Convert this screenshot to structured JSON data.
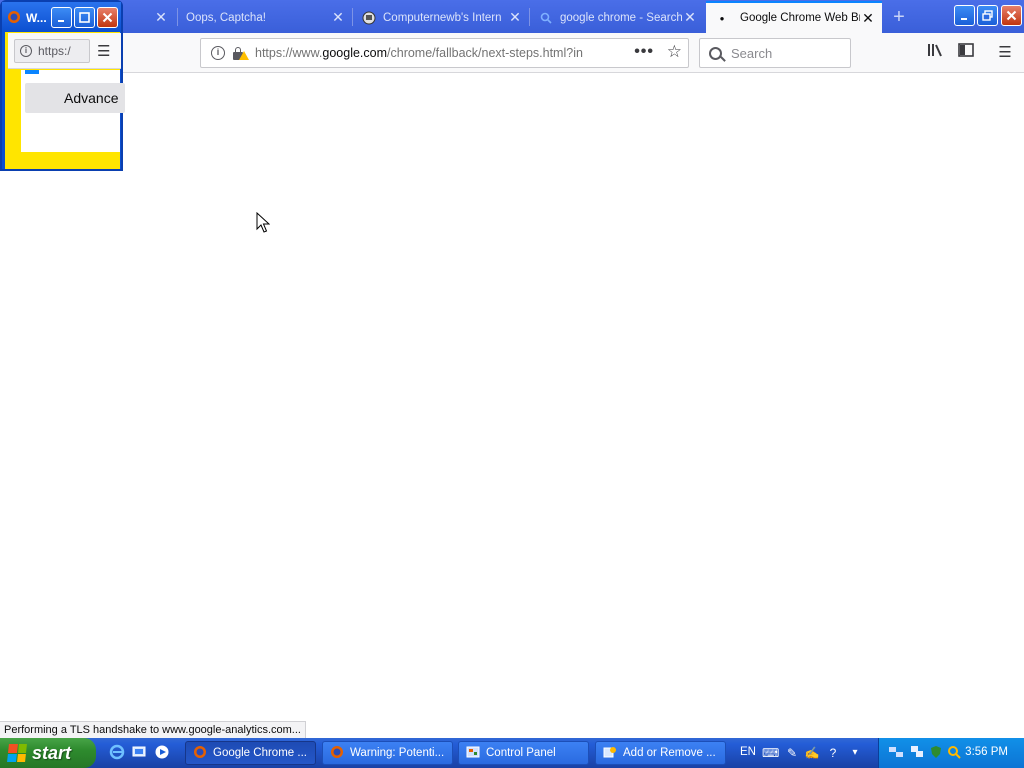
{
  "browser": {
    "tabs": [
      {
        "title": "",
        "favicon": "",
        "active": false
      },
      {
        "title": "Oops, Captcha!",
        "favicon": "",
        "active": false
      },
      {
        "title": "Computernewb's Intern",
        "favicon": "computernewb-icon",
        "active": false
      },
      {
        "title": "google chrome - Search",
        "favicon": "search-icon",
        "active": false
      },
      {
        "title": "Google Chrome Web Bro",
        "favicon": "loading-dot-icon",
        "active": true
      }
    ],
    "new_tab_symbol": "+",
    "url": {
      "scheme": "https://www.",
      "host": "google.com",
      "path": "/chrome/fallback/next-steps.html?in"
    },
    "search_placeholder": "Search",
    "page_actions_symbol": "•••"
  },
  "popup_window": {
    "title": "W...",
    "url_fragment": "https:/",
    "advanced_button": "Advance"
  },
  "status_bar": {
    "text": "Performing a TLS handshake to www.google-analytics.com..."
  },
  "taskbar": {
    "start_label": "start",
    "tasks": [
      {
        "label": "Google Chrome ...",
        "icon": "firefox-icon",
        "pressed": true
      },
      {
        "label": "Warning: Potenti...",
        "icon": "firefox-icon",
        "pressed": false
      },
      {
        "label": "Control Panel",
        "icon": "control-panel-icon",
        "pressed": false
      },
      {
        "label": "Add or Remove ...",
        "icon": "add-remove-programs-icon",
        "pressed": false
      }
    ],
    "language": "EN",
    "clock": "3:56 PM"
  },
  "colors": {
    "tabstrip": "#3a5fd9",
    "active_tab_accent": "#0a84ff",
    "taskbar": "#245dd7",
    "start_button": "#2e8b2e",
    "popup_page_background": "#ffe500"
  }
}
